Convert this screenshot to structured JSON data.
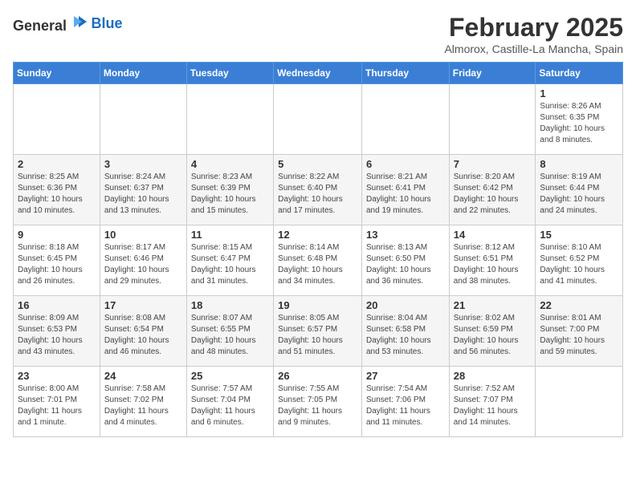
{
  "header": {
    "logo_general": "General",
    "logo_blue": "Blue",
    "month": "February 2025",
    "location": "Almorox, Castille-La Mancha, Spain"
  },
  "weekdays": [
    "Sunday",
    "Monday",
    "Tuesday",
    "Wednesday",
    "Thursday",
    "Friday",
    "Saturday"
  ],
  "weeks": [
    [
      {
        "day": "",
        "info": ""
      },
      {
        "day": "",
        "info": ""
      },
      {
        "day": "",
        "info": ""
      },
      {
        "day": "",
        "info": ""
      },
      {
        "day": "",
        "info": ""
      },
      {
        "day": "",
        "info": ""
      },
      {
        "day": "1",
        "info": "Sunrise: 8:26 AM\nSunset: 6:35 PM\nDaylight: 10 hours and 8 minutes."
      }
    ],
    [
      {
        "day": "2",
        "info": "Sunrise: 8:25 AM\nSunset: 6:36 PM\nDaylight: 10 hours and 10 minutes."
      },
      {
        "day": "3",
        "info": "Sunrise: 8:24 AM\nSunset: 6:37 PM\nDaylight: 10 hours and 13 minutes."
      },
      {
        "day": "4",
        "info": "Sunrise: 8:23 AM\nSunset: 6:39 PM\nDaylight: 10 hours and 15 minutes."
      },
      {
        "day": "5",
        "info": "Sunrise: 8:22 AM\nSunset: 6:40 PM\nDaylight: 10 hours and 17 minutes."
      },
      {
        "day": "6",
        "info": "Sunrise: 8:21 AM\nSunset: 6:41 PM\nDaylight: 10 hours and 19 minutes."
      },
      {
        "day": "7",
        "info": "Sunrise: 8:20 AM\nSunset: 6:42 PM\nDaylight: 10 hours and 22 minutes."
      },
      {
        "day": "8",
        "info": "Sunrise: 8:19 AM\nSunset: 6:44 PM\nDaylight: 10 hours and 24 minutes."
      }
    ],
    [
      {
        "day": "9",
        "info": "Sunrise: 8:18 AM\nSunset: 6:45 PM\nDaylight: 10 hours and 26 minutes."
      },
      {
        "day": "10",
        "info": "Sunrise: 8:17 AM\nSunset: 6:46 PM\nDaylight: 10 hours and 29 minutes."
      },
      {
        "day": "11",
        "info": "Sunrise: 8:15 AM\nSunset: 6:47 PM\nDaylight: 10 hours and 31 minutes."
      },
      {
        "day": "12",
        "info": "Sunrise: 8:14 AM\nSunset: 6:48 PM\nDaylight: 10 hours and 34 minutes."
      },
      {
        "day": "13",
        "info": "Sunrise: 8:13 AM\nSunset: 6:50 PM\nDaylight: 10 hours and 36 minutes."
      },
      {
        "day": "14",
        "info": "Sunrise: 8:12 AM\nSunset: 6:51 PM\nDaylight: 10 hours and 38 minutes."
      },
      {
        "day": "15",
        "info": "Sunrise: 8:10 AM\nSunset: 6:52 PM\nDaylight: 10 hours and 41 minutes."
      }
    ],
    [
      {
        "day": "16",
        "info": "Sunrise: 8:09 AM\nSunset: 6:53 PM\nDaylight: 10 hours and 43 minutes."
      },
      {
        "day": "17",
        "info": "Sunrise: 8:08 AM\nSunset: 6:54 PM\nDaylight: 10 hours and 46 minutes."
      },
      {
        "day": "18",
        "info": "Sunrise: 8:07 AM\nSunset: 6:55 PM\nDaylight: 10 hours and 48 minutes."
      },
      {
        "day": "19",
        "info": "Sunrise: 8:05 AM\nSunset: 6:57 PM\nDaylight: 10 hours and 51 minutes."
      },
      {
        "day": "20",
        "info": "Sunrise: 8:04 AM\nSunset: 6:58 PM\nDaylight: 10 hours and 53 minutes."
      },
      {
        "day": "21",
        "info": "Sunrise: 8:02 AM\nSunset: 6:59 PM\nDaylight: 10 hours and 56 minutes."
      },
      {
        "day": "22",
        "info": "Sunrise: 8:01 AM\nSunset: 7:00 PM\nDaylight: 10 hours and 59 minutes."
      }
    ],
    [
      {
        "day": "23",
        "info": "Sunrise: 8:00 AM\nSunset: 7:01 PM\nDaylight: 11 hours and 1 minute."
      },
      {
        "day": "24",
        "info": "Sunrise: 7:58 AM\nSunset: 7:02 PM\nDaylight: 11 hours and 4 minutes."
      },
      {
        "day": "25",
        "info": "Sunrise: 7:57 AM\nSunset: 7:04 PM\nDaylight: 11 hours and 6 minutes."
      },
      {
        "day": "26",
        "info": "Sunrise: 7:55 AM\nSunset: 7:05 PM\nDaylight: 11 hours and 9 minutes."
      },
      {
        "day": "27",
        "info": "Sunrise: 7:54 AM\nSunset: 7:06 PM\nDaylight: 11 hours and 11 minutes."
      },
      {
        "day": "28",
        "info": "Sunrise: 7:52 AM\nSunset: 7:07 PM\nDaylight: 11 hours and 14 minutes."
      },
      {
        "day": "",
        "info": ""
      }
    ]
  ]
}
